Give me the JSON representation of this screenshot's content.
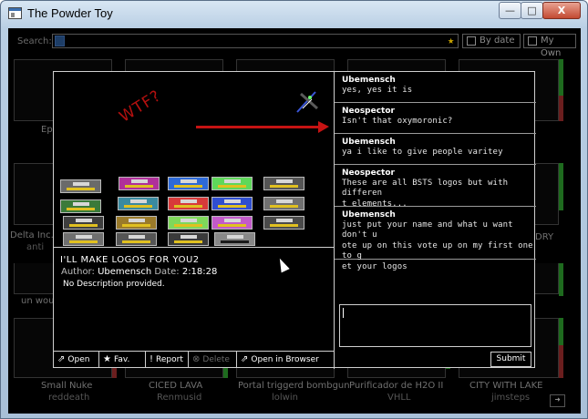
{
  "window": {
    "title": "The Powder Toy",
    "minimize_label": "—",
    "maximize_label": "□",
    "close_label": "X"
  },
  "browser": {
    "search_label": "Search:",
    "by_date_label": "By date",
    "my_own_label": "My Own",
    "thumb_captions": [
      {
        "title": "Ep",
        "author": ""
      },
      {
        "title": "DRY",
        "author": ""
      },
      {
        "title": "Delta Inc.",
        "author": "anti"
      },
      {
        "title": "un wou",
        "author": ""
      },
      {
        "title": "Small Nuke",
        "author": "reddeath"
      },
      {
        "title": "CICED LAVA",
        "author": "Renmusid"
      },
      {
        "title": "Portal triggerd bombgun",
        "author": "lolwin"
      },
      {
        "title": "Purificador de H2O II",
        "author": "VHLL"
      },
      {
        "title": "CITY WITH LAKE",
        "author": "jimsteps"
      }
    ]
  },
  "preview": {
    "thumb_text": "WTF?",
    "save_title": "I'LL MAKE LOGOS FOR YOU2",
    "author_label": "Author:",
    "author": "Ubemensch",
    "date_label": "Date:",
    "date": "2:18:28",
    "description": "No Description provided.",
    "actions": {
      "open": "Open",
      "fav": "Fav.",
      "report": "Report",
      "delete": "Delete",
      "open_browser": "Open in Browser"
    },
    "comments": [
      {
        "author": "Ubemensch",
        "lines": [
          "yes, yes it is"
        ]
      },
      {
        "author": "Neospector",
        "lines": [
          "Isn't that oxymoronic?"
        ]
      },
      {
        "author": "Ubemensch",
        "lines": [
          "ya i like to give people varitey"
        ]
      },
      {
        "author": "Neospector",
        "lines": [
          "These are all BSTS logos but with differen",
          "t elements..."
        ]
      },
      {
        "author": "Ubemensch",
        "lines": [
          "just put your name and what u want don't u",
          "ote up on this vote up on my first one to g",
          "et your logos"
        ]
      }
    ],
    "comment_input_value": "",
    "submit_label": "Submit"
  },
  "colors": {
    "arrow": "#c51313",
    "logo_yellow": "#e0c020"
  }
}
